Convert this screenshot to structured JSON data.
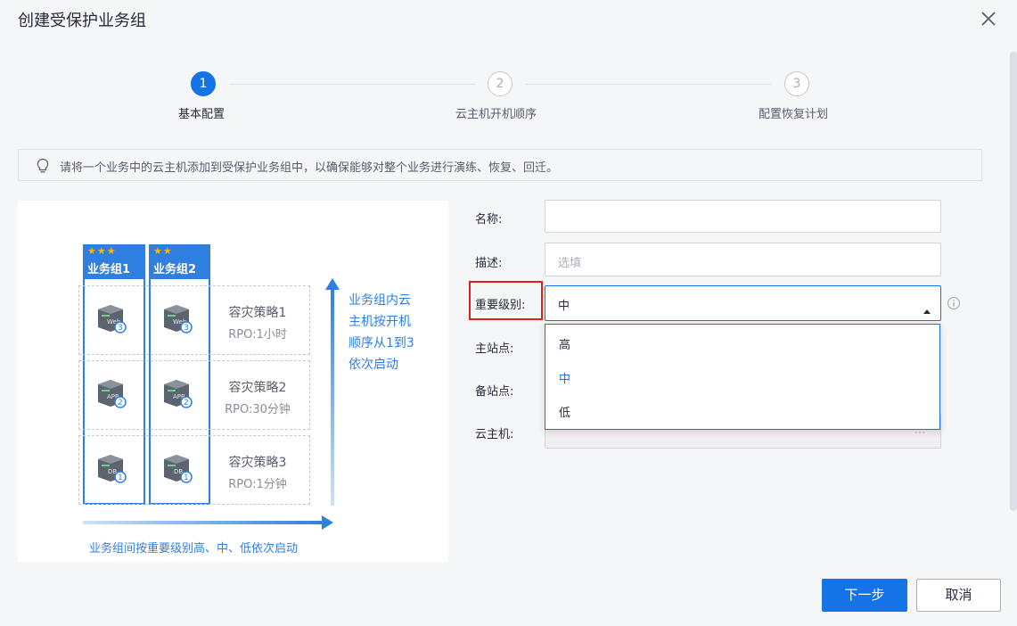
{
  "dialog": {
    "title": "创建受保护业务组"
  },
  "steps": [
    {
      "number": "1",
      "label": "基本配置",
      "state": "active"
    },
    {
      "number": "2",
      "label": "云主机开机顺序",
      "state": "inactive"
    },
    {
      "number": "3",
      "label": "配置恢复计划",
      "state": "inactive"
    }
  ],
  "tip": {
    "text": "请将一个业务中的云主机添加到受保护业务组中，以确保能够对整个业务进行演练、恢复、回迁。"
  },
  "illustration": {
    "groups": [
      {
        "stars": "★★★",
        "name": "业务组1"
      },
      {
        "stars": "★★",
        "name": "业务组2"
      }
    ],
    "rows": [
      {
        "server_label": "Web",
        "order": "3",
        "policy": "容灾策略1",
        "rpo": "RPO:1小时"
      },
      {
        "server_label": "APP",
        "order": "2",
        "policy": "容灾策略2",
        "rpo": "RPO:30分钟"
      },
      {
        "server_label": "DB",
        "order": "1",
        "policy": "容灾策略3",
        "rpo": "RPO:1分钟"
      }
    ],
    "side_text": [
      "业务组内云",
      "主机按开机",
      "顺序从1到3",
      "依次启动"
    ],
    "bottom_text": "业务组间按重要级别高、中、低依次启动"
  },
  "form": {
    "name": {
      "label": "名称:",
      "value": ""
    },
    "description": {
      "label": "描述:",
      "placeholder": "选填"
    },
    "importance": {
      "label": "重要级别:",
      "value": "中",
      "options": [
        "高",
        "中",
        "低"
      ]
    },
    "primary_site": {
      "label": "主站点:"
    },
    "backup_site": {
      "label": "备站点:"
    },
    "cloud_host": {
      "label": "云主机:"
    }
  },
  "buttons": {
    "next": "下一步",
    "cancel": "取消"
  },
  "colors": {
    "primary": "#1473e6",
    "highlight": "#e11d1d",
    "illustration_blue": "#2f7fe0"
  }
}
